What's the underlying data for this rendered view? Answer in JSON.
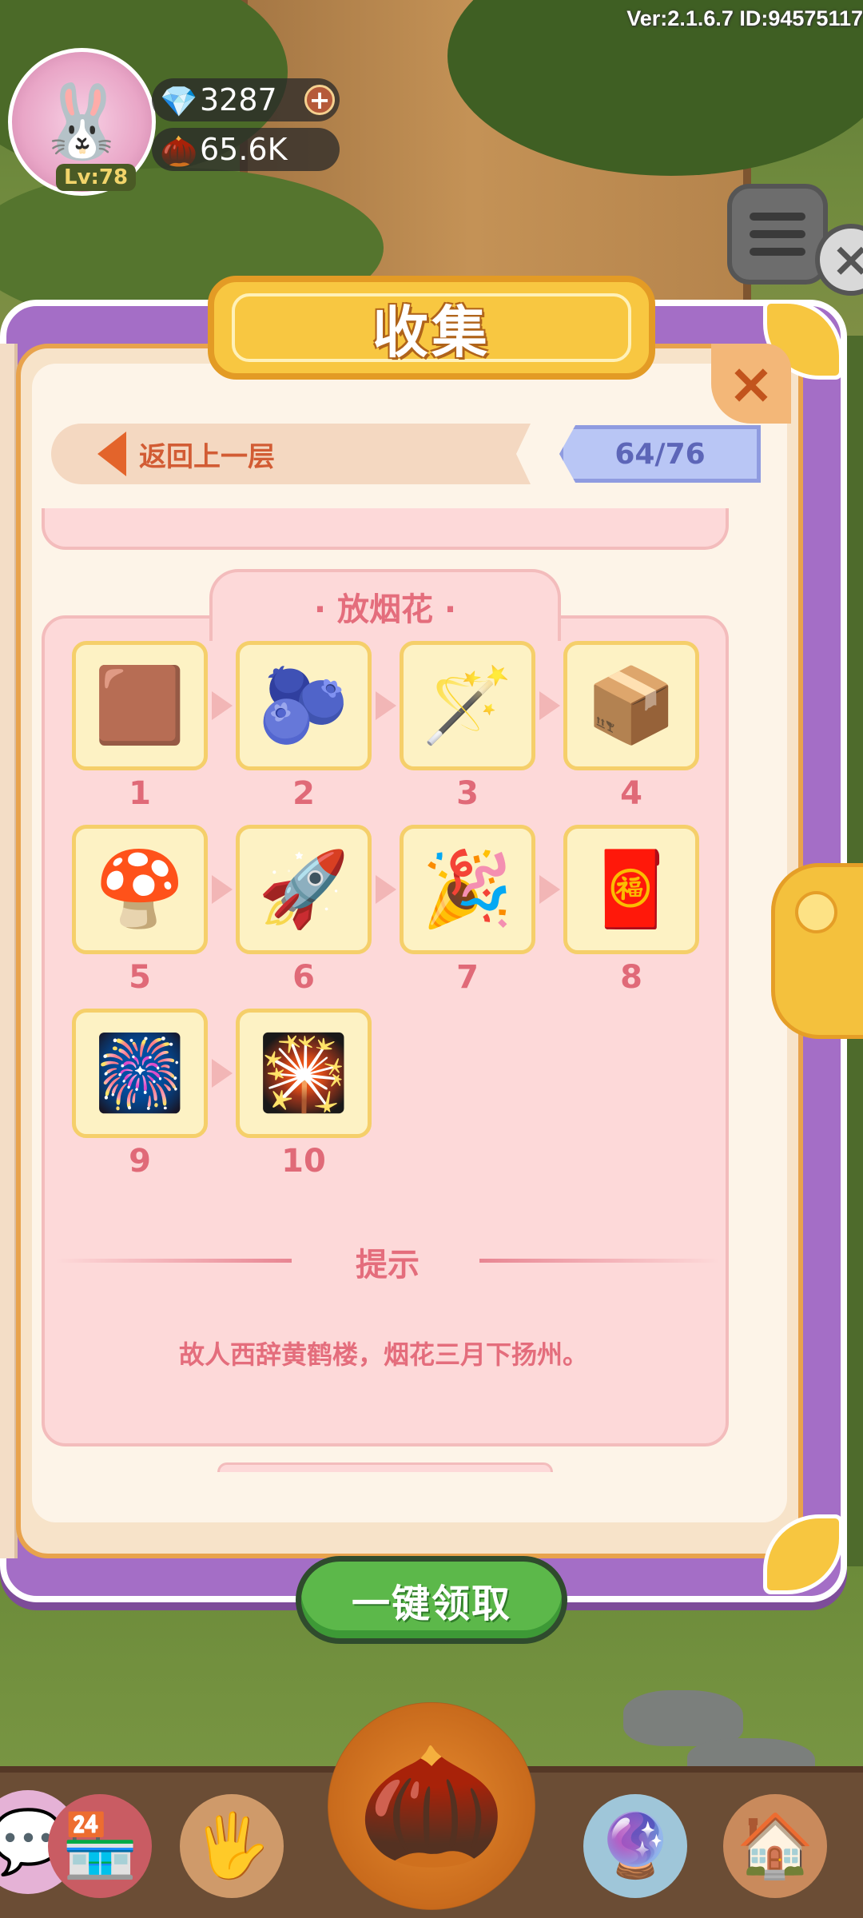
{
  "hud": {
    "version": "Ver:2.1.6.7 ID:94575117",
    "level": "Lv:78",
    "gems": "3287",
    "gem_plus": "+",
    "seeds": "65.6K"
  },
  "modal": {
    "title": "收集",
    "back_label": "返回上一层",
    "progress": "64/76",
    "close": "×",
    "set_title": "· 放烟花 ·",
    "items": [
      {
        "num": "1",
        "icon": "firework-powder-mat-icon",
        "glyph": "🟫"
      },
      {
        "num": "2",
        "icon": "berries-icon",
        "glyph": "🫐"
      },
      {
        "num": "3",
        "icon": "star-wand-icon",
        "glyph": "🪄"
      },
      {
        "num": "4",
        "icon": "matchbox-icon",
        "glyph": "📦"
      },
      {
        "num": "5",
        "icon": "mushroom-firework-icon",
        "glyph": "🍄"
      },
      {
        "num": "6",
        "icon": "rockets-icon",
        "glyph": "🚀"
      },
      {
        "num": "7",
        "icon": "cone-firework-icon",
        "glyph": "🎉"
      },
      {
        "num": "8",
        "icon": "firework-box-icon",
        "glyph": "🧧"
      },
      {
        "num": "9",
        "icon": "firework-set-icon",
        "glyph": "🎆"
      },
      {
        "num": "10",
        "icon": "firework-bundle-icon",
        "glyph": "🎇"
      }
    ],
    "hint_title": "提示",
    "hint_text": "故人西辞黄鹤楼，烟花三月下扬州。",
    "claim_label": "一键领取"
  }
}
